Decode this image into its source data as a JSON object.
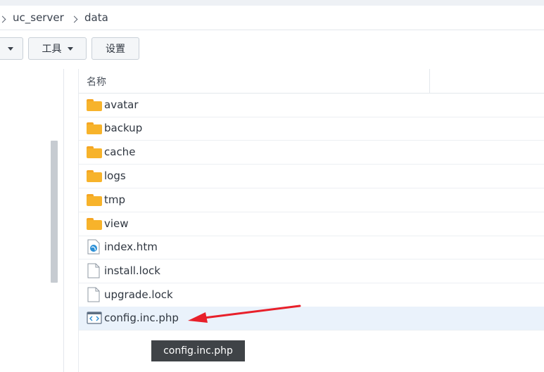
{
  "breadcrumb": {
    "items": [
      {
        "label": "uc_server"
      },
      {
        "label": "data"
      }
    ]
  },
  "toolbar": {
    "tools_label": "工具",
    "settings_label": "设置"
  },
  "file_list": {
    "column_name": "名称",
    "rows": [
      {
        "name": "avatar",
        "type": "folder"
      },
      {
        "name": "backup",
        "type": "folder"
      },
      {
        "name": "cache",
        "type": "folder"
      },
      {
        "name": "logs",
        "type": "folder"
      },
      {
        "name": "tmp",
        "type": "folder"
      },
      {
        "name": "view",
        "type": "folder"
      },
      {
        "name": "index.htm",
        "type": "html-file"
      },
      {
        "name": "install.lock",
        "type": "file"
      },
      {
        "name": "upgrade.lock",
        "type": "file"
      },
      {
        "name": "config.inc.php",
        "type": "code-file",
        "selected": true
      }
    ]
  },
  "tooltip": {
    "text": "config.inc.php"
  },
  "colors": {
    "folder": "#f7b32b",
    "selection": "#eaf2fb",
    "arrow": "#e8202a",
    "tooltip_bg": "#3f4347"
  }
}
